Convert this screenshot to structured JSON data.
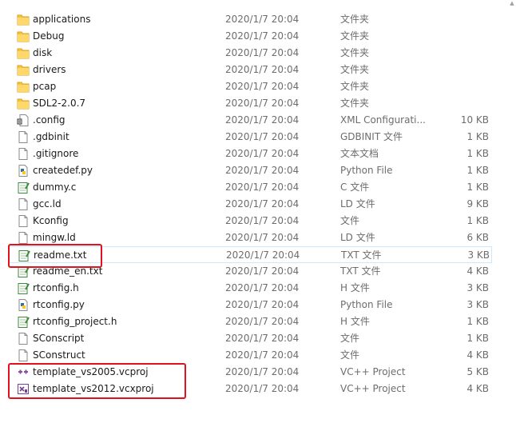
{
  "files": [
    {
      "name": "applications",
      "date": "2020/1/7 20:04",
      "type": "文件夹",
      "size": "",
      "icon": "folder-icon"
    },
    {
      "name": "Debug",
      "date": "2020/1/7 20:04",
      "type": "文件夹",
      "size": "",
      "icon": "folder-icon"
    },
    {
      "name": "disk",
      "date": "2020/1/7 20:04",
      "type": "文件夹",
      "size": "",
      "icon": "folder-icon"
    },
    {
      "name": "drivers",
      "date": "2020/1/7 20:04",
      "type": "文件夹",
      "size": "",
      "icon": "folder-icon"
    },
    {
      "name": "pcap",
      "date": "2020/1/7 20:04",
      "type": "文件夹",
      "size": "",
      "icon": "folder-icon"
    },
    {
      "name": "SDL2-2.0.7",
      "date": "2020/1/7 20:04",
      "type": "文件夹",
      "size": "",
      "icon": "folder-icon"
    },
    {
      "name": ".config",
      "date": "2020/1/7 20:04",
      "type": "XML Configurati...",
      "size": "10 KB",
      "icon": "config-file-icon"
    },
    {
      "name": ".gdbinit",
      "date": "2020/1/7 20:04",
      "type": "GDBINIT 文件",
      "size": "1 KB",
      "icon": "file-icon"
    },
    {
      "name": ".gitignore",
      "date": "2020/1/7 20:04",
      "type": "文本文档",
      "size": "1 KB",
      "icon": "file-icon"
    },
    {
      "name": "createdef.py",
      "date": "2020/1/7 20:04",
      "type": "Python File",
      "size": "1 KB",
      "icon": "python-file-icon"
    },
    {
      "name": "dummy.c",
      "date": "2020/1/7 20:04",
      "type": "C 文件",
      "size": "1 KB",
      "icon": "notepad-file-icon"
    },
    {
      "name": "gcc.ld",
      "date": "2020/1/7 20:04",
      "type": "LD 文件",
      "size": "9 KB",
      "icon": "file-icon"
    },
    {
      "name": "Kconfig",
      "date": "2020/1/7 20:04",
      "type": "文件",
      "size": "1 KB",
      "icon": "file-icon"
    },
    {
      "name": "mingw.ld",
      "date": "2020/1/7 20:04",
      "type": "LD 文件",
      "size": "6 KB",
      "icon": "file-icon"
    },
    {
      "name": "readme.txt",
      "date": "2020/1/7 20:04",
      "type": "TXT 文件",
      "size": "3 KB",
      "icon": "notepad-file-icon"
    },
    {
      "name": "readme_en.txt",
      "date": "2020/1/7 20:04",
      "type": "TXT 文件",
      "size": "4 KB",
      "icon": "notepad-file-icon"
    },
    {
      "name": "rtconfig.h",
      "date": "2020/1/7 20:04",
      "type": "H 文件",
      "size": "3 KB",
      "icon": "notepad-file-icon"
    },
    {
      "name": "rtconfig.py",
      "date": "2020/1/7 20:04",
      "type": "Python File",
      "size": "3 KB",
      "icon": "python-file-icon"
    },
    {
      "name": "rtconfig_project.h",
      "date": "2020/1/7 20:04",
      "type": "H 文件",
      "size": "1 KB",
      "icon": "notepad-file-icon"
    },
    {
      "name": "SConscript",
      "date": "2020/1/7 20:04",
      "type": "文件",
      "size": "1 KB",
      "icon": "file-icon"
    },
    {
      "name": "SConstruct",
      "date": "2020/1/7 20:04",
      "type": "文件",
      "size": "4 KB",
      "icon": "file-icon"
    },
    {
      "name": "template_vs2005.vcproj",
      "date": "2020/1/7 20:04",
      "type": "VC++ Project",
      "size": "5 KB",
      "icon": "vcproj-file-icon"
    },
    {
      "name": "template_vs2012.vcxproj",
      "date": "2020/1/7 20:04",
      "type": "VC++ Project",
      "size": "4 KB",
      "icon": "vcxproj-file-icon"
    }
  ],
  "selected_name": "readme.txt",
  "colors": {
    "highlight": "#e0121f",
    "folder": "#f5c443",
    "selected_border": "#cce8ff"
  }
}
